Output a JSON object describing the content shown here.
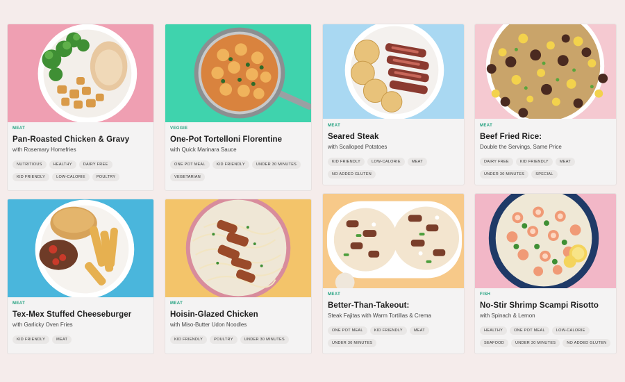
{
  "cards": [
    {
      "category": "MEAT",
      "title": "Pan-Roasted Chicken & Gravy",
      "subtitle": "with Rosemary Homefries",
      "tags": [
        "NUTRITIOUS",
        "HEALTHY",
        "DAIRY FREE",
        "KID FRIENDLY",
        "LOW-CALORIE",
        "POULTRY"
      ]
    },
    {
      "category": "VEGGIE",
      "title": "One-Pot Tortelloni Florentine",
      "subtitle": "with Quick Marinara Sauce",
      "tags": [
        "ONE POT MEAL",
        "KID FRIENDLY",
        "UNDER 30 MINUTES",
        "VEGETARIAN"
      ]
    },
    {
      "category": "MEAT",
      "title": "Seared Steak",
      "subtitle": "with Scalloped Potatoes",
      "tags": [
        "KID FRIENDLY",
        "LOW-CALORIE",
        "MEAT",
        "NO ADDED GLUTEN"
      ]
    },
    {
      "category": "MEAT",
      "title": "Beef Fried Rice:",
      "subtitle": "Double the Servings, Same Price",
      "tags": [
        "DAIRY FREE",
        "KID FRIENDLY",
        "MEAT",
        "UNDER 30 MINUTES",
        "SPECIAL"
      ]
    },
    {
      "category": "MEAT",
      "title": "Tex-Mex Stuffed Cheeseburger",
      "subtitle": "with Garlicky Oven Fries",
      "tags": [
        "KID FRIENDLY",
        "MEAT"
      ]
    },
    {
      "category": "MEAT",
      "title": "Hoisin-Glazed Chicken",
      "subtitle": "with Miso-Butter Udon Noodles",
      "tags": [
        "KID FRIENDLY",
        "POULTRY",
        "UNDER 30 MINUTES"
      ]
    },
    {
      "category": "MEAT",
      "title": "Better-Than-Takeout:",
      "subtitle": "Steak Fajitas with Warm Tortillas & Crema",
      "tags": [
        "ONE POT MEAL",
        "KID FRIENDLY",
        "MEAT",
        "UNDER 30 MINUTES"
      ]
    },
    {
      "category": "FISH",
      "title": "No-Stir Shrimp Scampi Risotto",
      "subtitle": "with Spinach & Lemon",
      "tags": [
        "HEALTHY",
        "ONE POT MEAL",
        "LOW-CALORIE",
        "SEAFOOD",
        "UNDER 30 MINUTES",
        "NO ADDED GLUTEN"
      ]
    }
  ],
  "image_backgrounds": [
    "#ef9fb2",
    "#3fd3ad",
    "#a9d8f2",
    "#f5c9d1",
    "#4ab6dc",
    "#f3c46a",
    "#f7c989",
    "#f2b7c7"
  ],
  "accent_color": "#1fa07e"
}
